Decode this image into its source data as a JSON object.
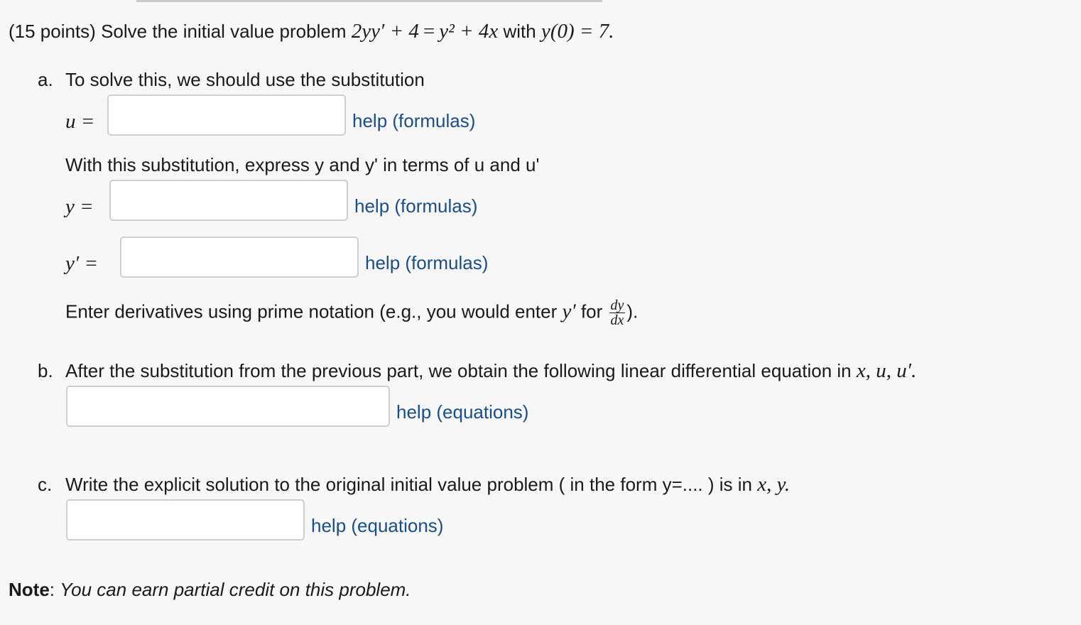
{
  "problem": {
    "points": "(15 points)",
    "intro": "Solve the initial value problem",
    "equation": {
      "lhs": "2yy′ + 4",
      "eq": "=",
      "rhs": "y² + 4x"
    },
    "with_label": "with",
    "initial_condition": "y(0) = 7."
  },
  "part_a": {
    "marker": "a.",
    "prompt": "To solve this, we should use the substitution",
    "u_label": "u =",
    "u_value": "",
    "help": "help (formulas)",
    "express_prompt": "With this substitution, express y and y' in terms of u and u'",
    "y_label": "y =",
    "y_value": "",
    "yp_label": "y′ =",
    "yp_value": "",
    "deriv_note_prefix": "Enter derivatives using prime notation (e.g., you would enter",
    "deriv_note_math": "y′",
    "deriv_note_for": "for",
    "frac_num": "dy",
    "frac_den": "dx",
    "deriv_note_suffix": ")."
  },
  "part_b": {
    "marker": "b.",
    "prompt": "After the substitution from the previous part, we obtain the following linear differential equation in",
    "vars": "x, u, u′.",
    "value": "",
    "help": "help (equations)"
  },
  "part_c": {
    "marker": "c.",
    "prompt": "Write the explicit solution to the original initial value problem ( in the form y=.... ) is in",
    "vars": "x, y.",
    "value": "",
    "help": "help (equations)"
  },
  "note": {
    "label": "Note",
    "colon": ":",
    "text": "You can earn partial credit on this problem."
  }
}
